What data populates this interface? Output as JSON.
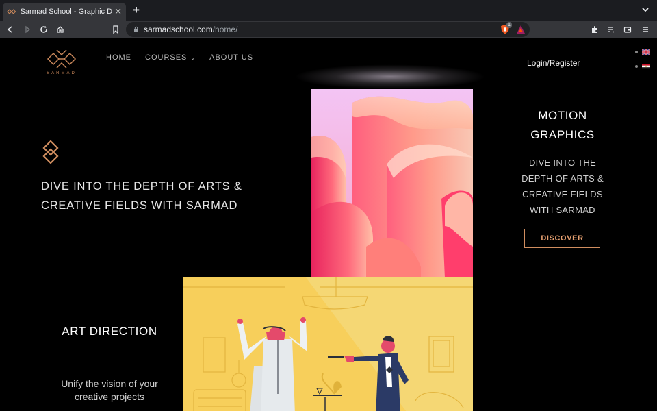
{
  "browser": {
    "tab_title": "Sarmad School - Graphic Desig",
    "tab_close": "✕",
    "new_tab": "+",
    "url_host": "sarmadschool.com",
    "url_path": "/home/",
    "brave_shield_count": "1",
    "icons": [
      "back-icon",
      "forward-icon",
      "reload-icon",
      "home-icon",
      "bookmark-icon",
      "lock-icon",
      "brave-shield-icon",
      "bat-rewards-icon",
      "extensions-icon",
      "playlist-icon",
      "wallet-icon",
      "menu-icon"
    ]
  },
  "site": {
    "logo_text": "SARMAD",
    "nav": [
      {
        "label": "HOME"
      },
      {
        "label": "COURSES",
        "caret": "⌄"
      },
      {
        "label": "ABOUT US"
      }
    ],
    "login_label": "Login/Register",
    "languages": [
      "english-flag-icon",
      "egypt-flag-icon"
    ],
    "hero_title": "DIVE INTO THE DEPTH OF ARTS & CREATIVE FIELDS WITH SARMAD",
    "motion": {
      "title": "MOTION GRAPHICS",
      "text": "DIVE INTO THE DEPTH OF ARTS & CREATIVE FIELDS WITH SARMAD",
      "button": "DISCOVER"
    },
    "art_direction": {
      "title": "ART DIRECTION",
      "text": "Unify the vision of your creative projects"
    }
  },
  "colors": {
    "accent": "#d08d5f",
    "background": "#000000",
    "chrome_dark": "#1b1c20",
    "chrome": "#35363a",
    "illustration_yellow": "#f7cf5b"
  }
}
